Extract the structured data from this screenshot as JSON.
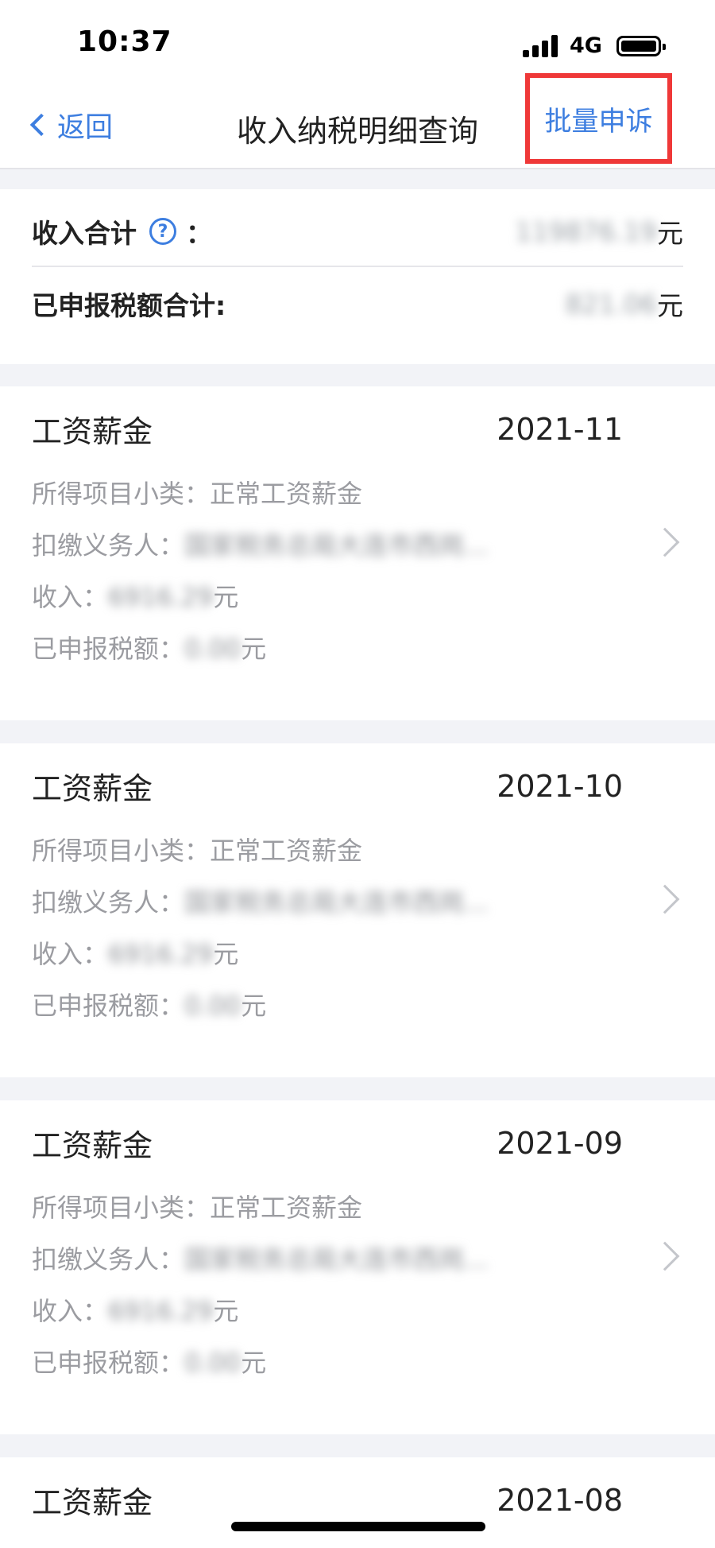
{
  "status_bar": {
    "time": "10:37",
    "network": "4G"
  },
  "nav": {
    "back_label": "返回",
    "title": "收入纳税明细查询",
    "action_label": "批量申诉"
  },
  "summary": {
    "income_total_label": "收入合计",
    "income_total_colon": "：",
    "income_total_value": "119876.19",
    "tax_total_label": "已申报税额合计:",
    "tax_total_value": "821.06",
    "unit": "元"
  },
  "labels": {
    "subcategory": "所得项目小类：",
    "withholder": "扣缴义务人：",
    "income": "收入：",
    "tax": "已申报税额：",
    "unit": "元"
  },
  "records": [
    {
      "title": "工资薪金",
      "date": "2021-11",
      "subcategory": "正常工资薪金",
      "withholder": "国家税务总局大连市西岗...",
      "income": "6916.29",
      "tax": "0.00"
    },
    {
      "title": "工资薪金",
      "date": "2021-10",
      "subcategory": "正常工资薪金",
      "withholder": "国家税务总局大连市西岗...",
      "income": "6916.29",
      "tax": "0.00"
    },
    {
      "title": "工资薪金",
      "date": "2021-09",
      "subcategory": "正常工资薪金",
      "withholder": "国家税务总局大连市西岗...",
      "income": "6916.29",
      "tax": "0.00"
    },
    {
      "title": "工资薪金",
      "date": "2021-08"
    }
  ],
  "colors": {
    "accent": "#3d7ee0",
    "highlight_box": "#ef3838",
    "secondary_text": "#9b9ca1"
  }
}
